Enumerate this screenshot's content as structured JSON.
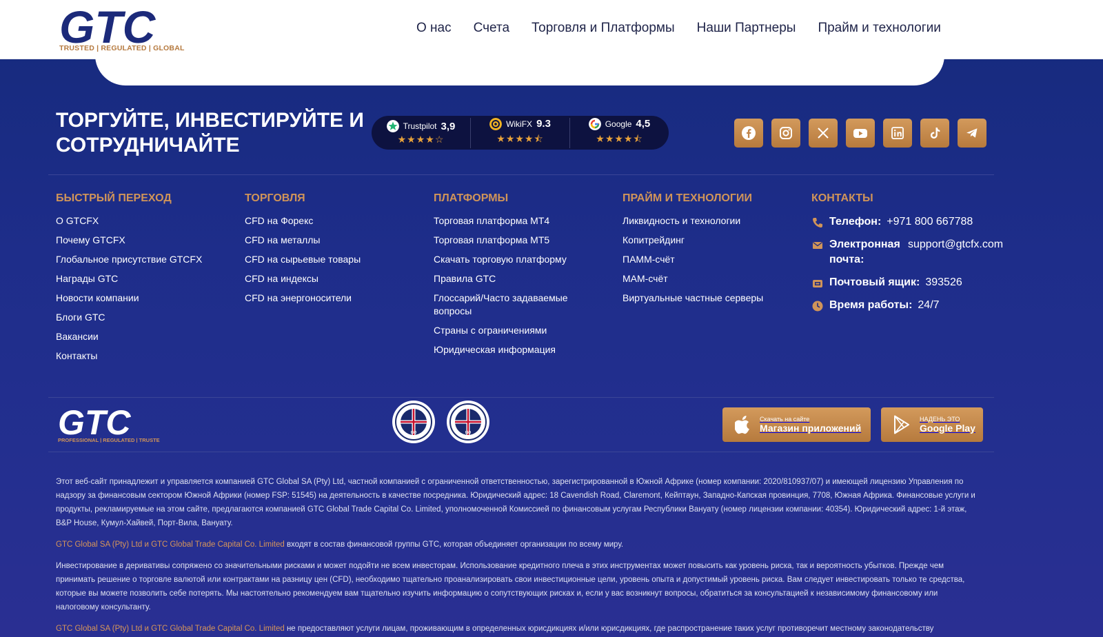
{
  "header": {
    "logo_text": "GTC",
    "logo_tagline": "TRUSTED | REGULATED | GLOBAL",
    "nav": [
      "О нас",
      "Счета",
      "Торговля и Платформы",
      "Наши Партнеры",
      "Прайм и технологии"
    ]
  },
  "hero": {
    "headline": "ТОРГУЙТЕ, ИНВЕСТИРУЙТЕ И СОТРУДНИЧАЙТЕ"
  },
  "ratings": [
    {
      "name": "Trustpilot",
      "score": "3,9",
      "stars": 4,
      "icon": "trustpilot-star-icon",
      "color": "#22b573"
    },
    {
      "name": "WikiFX",
      "score": "9.3",
      "stars": 4.5,
      "icon": "wikifx-icon",
      "color": "#f0b323"
    },
    {
      "name": "Google",
      "score": "4,5",
      "stars": 4.5,
      "icon": "google-icon",
      "color": "#4285f4"
    }
  ],
  "socials": [
    "facebook-icon",
    "instagram-icon",
    "x-icon",
    "youtube-icon",
    "linkedin-icon",
    "tiktok-icon",
    "telegram-icon"
  ],
  "columns": {
    "quick": {
      "title": "Быстрый переход",
      "items": [
        "О GTCFX",
        "Почему GTCFX",
        "Глобальное присутствие GTCFX",
        "Награды GTC",
        "Новости компании",
        "Блоги GTC",
        "Вакансии",
        "Контакты"
      ]
    },
    "trading": {
      "title": "Торговля",
      "items": [
        "CFD на Форекс",
        "CFD на металлы",
        "CFD на сырьевые товары",
        "CFD на индексы",
        "CFD на энергоносители"
      ]
    },
    "platforms": {
      "title": "Платформы",
      "items": [
        "Торговая платформа MT4",
        "Торговая платформа MT5",
        "Скачать торговую платформу",
        "Правила GTC",
        "Глоссарий/Часто задаваемые вопросы",
        "Страны с ограничениями",
        "Юридическая информация"
      ]
    },
    "prime": {
      "title": "Прайм и технологии",
      "items": [
        "Ликвидность и технологии",
        "Копитрейдинг",
        "ПАММ-счёт",
        "МАМ-счёт",
        "Виртуальные частные серверы"
      ]
    },
    "contacts": {
      "title": "Контакты",
      "phone_label": "Телефон:",
      "phone": "+971 800 667788",
      "email_label": "Электронная почта:",
      "email": "support@gtcfx.com",
      "pobox_label": "Почтовый ящик:",
      "pobox": "393526",
      "hours_label": "Время работы:",
      "hours": "24/7"
    }
  },
  "bottom": {
    "logo_text": "GTC",
    "logo_tagline": "PROFESSIONAL | REGULATED | TRUSTED",
    "seal_text": "ISO",
    "appstore_small": "Скачать на сайте",
    "appstore_big": "Магазин приложений",
    "gplay_small": "НАДЕНЬ ЭТО",
    "gplay_big": "Google Play"
  },
  "legal": {
    "p1": "Этот веб-сайт принадлежит и управляется компанией GTC Global SA (Pty) Ltd, частной компанией с ограниченной ответственностью, зарегистрированной в Южной Африке (номер компании: 2020/810937/07) и имеющей лицензию Управления по надзору за финансовым сектором Южной Африки (номер FSP: 51545) на деятельность в качестве посредника. Юридический адрес: 18 Cavendish Road, Claremont, Кейптаун, Западно-Капская провинция, 7708, Южная Африка. Финансовые услуги и продукты, рекламируемые на этом сайте, предлагаются компанией GTC Global Trade Capital Co. Limited, уполномоченной Комиссией по финансовым услугам Республики Вануату (номер лицензии компании: 40354). Юридический адрес: 1-й этаж, B&P House, Кумул-Хайвей, Порт-Вила, Вануату.",
    "p2_hl": "GTC Global SA (Pty) Ltd и GTC Global Trade Capital Co. Limited",
    "p2_rest": " входят в состав финансовой группы GTC, которая объединяет организации по всему миру.",
    "p3": "Инвестирование в деривативы сопряжено со значительными рисками и может подойти не всем инвесторам. Использование кредитного плеча в этих инструментах может повысить как уровень риска, так и вероятность убытков. Прежде чем принимать решение о торговле валютой или контрактами на разницу цен (CFD), необходимо тщательно проанализировать свои инвестиционные цели, уровень опыта и допустимый уровень риска. Вам следует инвестировать только те средства, которые вы можете позволить себе потерять. Мы настоятельно рекомендуем вам тщательно изучить информацию о сопутствующих рисках и, если у вас возникнут вопросы, обратиться за консультацией к независимому финансовому или налоговому консультанту.",
    "p4_hl": "GTC Global SA (Pty) Ltd и GTC Global Trade Capital Co. Limited",
    "p4_rest": " не предоставляют услуги лицам, проживающим в определенных юрисдикциях и/или юрисдикциях, где распространение таких услуг противоречит местному законодательству"
  },
  "colors": {
    "background": "#1f2b80",
    "accent": "#d09459",
    "ratings_bg": "#0d1240",
    "star": "#e8a23a"
  }
}
